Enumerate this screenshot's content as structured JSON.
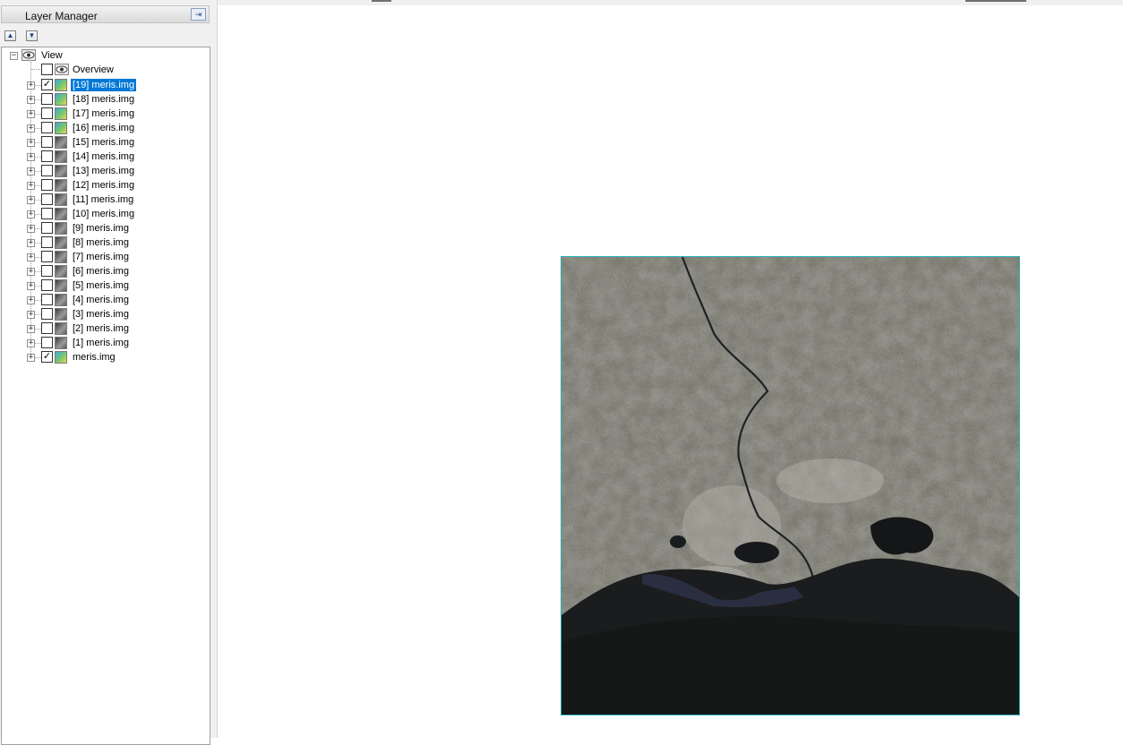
{
  "panel": {
    "title": "Layer Manager",
    "pin_icon": "pin-icon",
    "move_up_icon": "arrow-up-icon",
    "move_down_icon": "arrow-down-icon"
  },
  "tree": {
    "root": {
      "label": "View",
      "icon": "eye-icon",
      "expanded": true
    },
    "overview": {
      "label": "Overview",
      "icon": "eye-icon",
      "checked": false
    },
    "layers": [
      {
        "label": "[19] meris.img",
        "checked": true,
        "icon": "rgb-raster-icon",
        "selected": true
      },
      {
        "label": "[18] meris.img",
        "checked": false,
        "icon": "rgb-raster-icon"
      },
      {
        "label": "[17] meris.img",
        "checked": false,
        "icon": "rgb-raster-icon"
      },
      {
        "label": "[16] meris.img",
        "checked": false,
        "icon": "rgb-raster-icon"
      },
      {
        "label": "[15] meris.img",
        "checked": false,
        "icon": "gray-raster-icon"
      },
      {
        "label": "[14] meris.img",
        "checked": false,
        "icon": "gray-raster-icon"
      },
      {
        "label": "[13] meris.img",
        "checked": false,
        "icon": "gray-raster-icon"
      },
      {
        "label": "[12] meris.img",
        "checked": false,
        "icon": "gray-raster-icon"
      },
      {
        "label": "[11] meris.img",
        "checked": false,
        "icon": "gray-raster-icon"
      },
      {
        "label": "[10] meris.img",
        "checked": false,
        "icon": "gray-raster-icon"
      },
      {
        "label": "[9] meris.img",
        "checked": false,
        "icon": "gray-raster-icon"
      },
      {
        "label": "[8] meris.img",
        "checked": false,
        "icon": "gray-raster-icon"
      },
      {
        "label": "[7] meris.img",
        "checked": false,
        "icon": "gray-raster-icon"
      },
      {
        "label": "[6] meris.img",
        "checked": false,
        "icon": "gray-raster-icon"
      },
      {
        "label": "[5] meris.img",
        "checked": false,
        "icon": "gray-raster-icon"
      },
      {
        "label": "[4] meris.img",
        "checked": false,
        "icon": "gray-raster-icon"
      },
      {
        "label": "[3] meris.img",
        "checked": false,
        "icon": "gray-raster-icon"
      },
      {
        "label": "[2] meris.img",
        "checked": false,
        "icon": "gray-raster-icon"
      },
      {
        "label": "[1] meris.img",
        "checked": false,
        "icon": "gray-raster-icon"
      },
      {
        "label": "meris.img",
        "checked": true,
        "icon": "rgb-raster-icon"
      }
    ]
  },
  "viewer": {
    "image": "satellite-raster-image",
    "border_color": "#2ab3b8"
  },
  "colors": {
    "selection": "#0078d7",
    "panel_bg": "#f0f0f0"
  }
}
